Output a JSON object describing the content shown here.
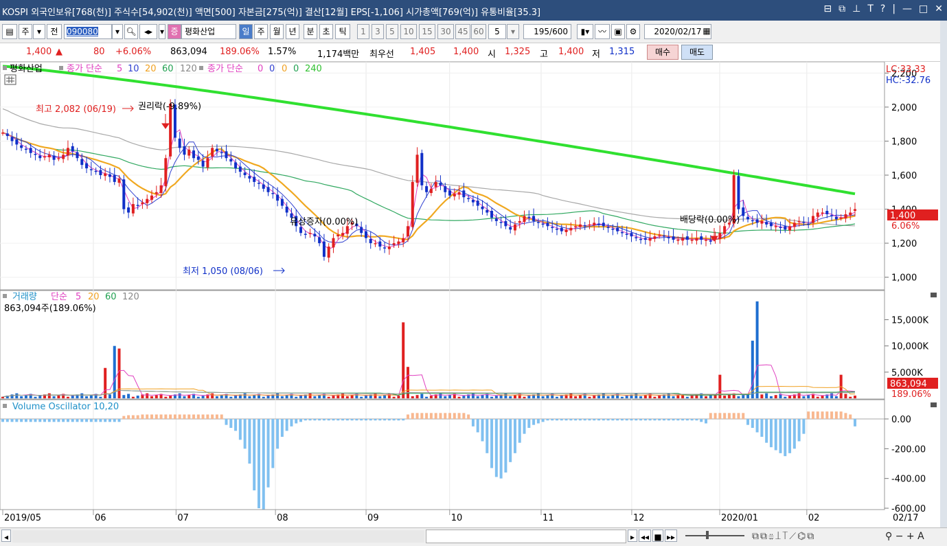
{
  "window": {
    "title": "KOSPI 외국인보유[768(천)] 주식수[54,902(천)] 액면[500] 자본금[275(억)] 결산[12월] EPS[-1,106] 시가총액[769(억)] 유통비율[35.3]",
    "controls": [
      "⊟",
      "⧉",
      "⊥",
      "T",
      "?",
      "|",
      "—",
      "□",
      "✕"
    ]
  },
  "toolbar": {
    "mode": "주",
    "prev_label": "전",
    "code": "090080",
    "name": "평화산업",
    "periods": [
      "일",
      "주",
      "월",
      "년",
      "분",
      "초",
      "틱"
    ],
    "minutes": [
      "1",
      "3",
      "5",
      "10",
      "15",
      "30",
      "45",
      "60"
    ],
    "interval": "5",
    "count": "195",
    "count_total": "/600",
    "date": "2020/02/17",
    "stock_badge": "증"
  },
  "quote": {
    "price": "1,400",
    "up_arrow": "▲",
    "change": "80",
    "change_pct": "+6.06%",
    "volume": "863,094",
    "volume_pct": "189.06%",
    "turnover": "1.57%",
    "amount": "1,174백만",
    "best_label": "최우선",
    "best_ask": "1,405",
    "best_bid": "1,400",
    "open_label": "시",
    "open": "1,325",
    "high_label": "고",
    "high": "1,400",
    "low_label": "저",
    "low": "1,315",
    "buy_label": "매수",
    "sell_label": "매도"
  },
  "price_panel": {
    "legend_name": "평화산업",
    "legend_ma_label": "종가 단순",
    "legend_ma": [
      "5",
      "10",
      "20",
      "60",
      "120"
    ],
    "legend_ma2_label": "종가 단순",
    "legend_ma2": [
      "0",
      "0",
      "0",
      "0",
      "240"
    ],
    "lc": "LC:33.33",
    "hc": "HC:-32.76",
    "last_price": "1,400",
    "last_pct": "6.06%",
    "annotations": {
      "high": "최고 2,082 (06/19)",
      "low": "최저 1,050 (08/06)",
      "rights": "권리락(-9.89%)",
      "paid_in": "유상증자(0.00%)",
      "dividend": "배당락(0.00%)"
    },
    "yticks": [
      "2,200",
      "2,000",
      "1,800",
      "1,600",
      "1,400",
      "1,200",
      "1,000"
    ]
  },
  "volume_panel": {
    "legend_name": "거래량",
    "legend_ma_label": "단순",
    "legend_ma": [
      "5",
      "20",
      "60",
      "120"
    ],
    "current": "863,094주(189.06%)",
    "last_value": "863,094",
    "last_pct": "189.06%",
    "yticks": [
      "15,000K",
      "10,000K",
      "5,000K"
    ]
  },
  "osc_panel": {
    "legend": "Volume Oscillator 10,20",
    "yticks": [
      "0.00",
      "-200.00",
      "-400.00",
      "-600.00"
    ]
  },
  "xaxis": [
    "2019/05",
    "06",
    "07",
    "08",
    "09",
    "10",
    "11",
    "12",
    "2020/01",
    "02"
  ],
  "xaxis_last": "02/17",
  "chart_data": [
    {
      "type": "candlestick",
      "title": "평화산업",
      "ylim": [
        950,
        2250
      ],
      "y_max_label": 2200,
      "period": "daily",
      "date_range": [
        "2019/05",
        "2020/02/17"
      ],
      "highest": {
        "value": 2082,
        "date": "06/19"
      },
      "lowest": {
        "value": 1050,
        "date": "08/06"
      },
      "last": 1400,
      "series_ma": [
        {
          "name": "5",
          "color": "#e040c0"
        },
        {
          "name": "10",
          "color": "#3040d0"
        },
        {
          "name": "20",
          "color": "#f0a020"
        },
        {
          "name": "60",
          "color": "#20a050"
        },
        {
          "name": "120",
          "color": "#a0a0a0"
        },
        {
          "name": "240",
          "color": "#30e030"
        }
      ],
      "close": [
        1850,
        1830,
        1800,
        1780,
        1760,
        1750,
        1730,
        1720,
        1700,
        1710,
        1720,
        1690,
        1700,
        1720,
        1760,
        1740,
        1700,
        1660,
        1640,
        1630,
        1620,
        1600,
        1610,
        1590,
        1560,
        1580,
        1400,
        1380,
        1430,
        1420,
        1440,
        1460,
        1480,
        1500,
        1540,
        1700,
        2020,
        1820,
        1760,
        1720,
        1750,
        1700,
        1690,
        1650,
        1700,
        1760,
        1740,
        1730,
        1700,
        1680,
        1640,
        1620,
        1600,
        1580,
        1560,
        1550,
        1520,
        1500,
        1490,
        1450,
        1420,
        1380,
        1350,
        1300,
        1260,
        1250,
        1260,
        1240,
        1200,
        1120,
        1180,
        1230,
        1250,
        1260,
        1300,
        1320,
        1300,
        1260,
        1230,
        1200,
        1200,
        1180,
        1170,
        1180,
        1200,
        1210,
        1230,
        1300,
        1560,
        1720,
        1540,
        1500,
        1520,
        1560,
        1540,
        1500,
        1480,
        1490,
        1500,
        1470,
        1460,
        1440,
        1420,
        1400,
        1380,
        1350,
        1330,
        1320,
        1300,
        1280,
        1310,
        1330,
        1360,
        1350,
        1330,
        1320,
        1310,
        1300,
        1290,
        1280,
        1270,
        1280,
        1290,
        1300,
        1310,
        1300,
        1310,
        1320,
        1310,
        1300,
        1290,
        1280,
        1270,
        1260,
        1250,
        1240,
        1230,
        1220,
        1220,
        1230,
        1240,
        1250,
        1240,
        1230,
        1220,
        1220,
        1230,
        1220,
        1220,
        1230,
        1220,
        1220,
        1210,
        1230,
        1260,
        1300,
        1320,
        1600,
        1400,
        1360,
        1340,
        1330,
        1320,
        1330,
        1310,
        1300,
        1300,
        1290,
        1280,
        1300,
        1320,
        1330,
        1320,
        1310,
        1360,
        1380,
        1380,
        1370,
        1360,
        1340,
        1350,
        1370,
        1380,
        1400
      ]
    },
    {
      "type": "bar",
      "title": "거래량",
      "unit": "K shares",
      "ylim": [
        0,
        19000
      ],
      "peaks": [
        {
          "x": "06/19",
          "value": 10000
        },
        {
          "x": "09",
          "value": 14500
        },
        {
          "x": "12",
          "value": 4500
        },
        {
          "x": "2020/01",
          "value": 18500
        }
      ],
      "last": 863.094
    },
    {
      "type": "bar",
      "title": "Volume Oscillator 10,20",
      "ylim": [
        -650,
        60
      ],
      "series": [
        {
          "name": "Volume Oscillator 10,20",
          "values": [
            -20,
            -20,
            -20,
            -20,
            -20,
            -20,
            -20,
            -20,
            -20,
            -20,
            -20,
            -20,
            -20,
            -20,
            -20,
            -20,
            -20,
            -20,
            -20,
            -20,
            -20,
            -20,
            -20,
            -20,
            -20,
            -20,
            20,
            25,
            25,
            25,
            30,
            30,
            30,
            30,
            30,
            30,
            30,
            30,
            30,
            30,
            30,
            30,
            30,
            30,
            30,
            30,
            30,
            30,
            -40,
            -60,
            -80,
            -140,
            -200,
            -300,
            -480,
            -600,
            -610,
            -460,
            -330,
            -200,
            -120,
            -80,
            -50,
            -30,
            -20,
            -10,
            -10,
            -10,
            -10,
            -10,
            -10,
            -10,
            -10,
            -10,
            -10,
            -10,
            -10,
            -10,
            -10,
            -10,
            -10,
            -10,
            -10,
            -10,
            -10,
            -10,
            -10,
            30,
            40,
            40,
            40,
            40,
            40,
            40,
            40,
            40,
            40,
            40,
            40,
            40,
            30,
            -50,
            -90,
            -150,
            -230,
            -330,
            -390,
            -400,
            -360,
            -290,
            -230,
            -160,
            -100,
            -60,
            -40,
            -30,
            -20,
            -10,
            -10,
            -10,
            -10,
            -10,
            -10,
            -10,
            -10,
            -10,
            -10,
            -10,
            -10,
            -10,
            -10,
            -10,
            -10,
            -10,
            -10,
            -10,
            -10,
            -10,
            -10,
            -10,
            -10,
            -10,
            -10,
            -10,
            -10,
            -10,
            -10,
            -10,
            -10,
            -10,
            -20,
            -30,
            40,
            40,
            40,
            40,
            40,
            40,
            40,
            40,
            -40,
            -60,
            -90,
            -120,
            -160,
            -190,
            -210,
            -230,
            -250,
            -230,
            -200,
            -150,
            -100,
            50,
            50,
            50,
            50,
            50,
            50,
            50,
            50,
            40,
            30,
            -50,
            -120,
            -160,
            -180,
            -170,
            -150,
            -120,
            -80,
            -60,
            -40,
            -20,
            -10,
            30
          ]
        }
      ]
    }
  ]
}
